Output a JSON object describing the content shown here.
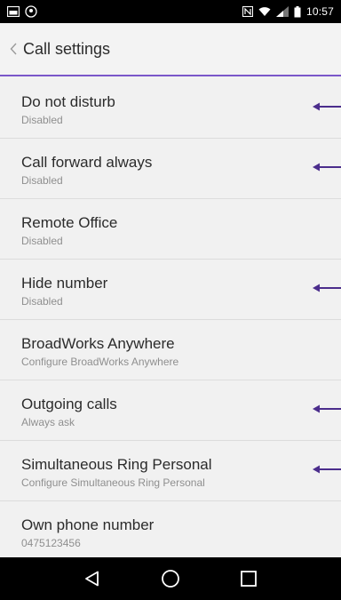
{
  "status_bar": {
    "time": "10:57",
    "left_icons": [
      "gallery-icon",
      "notification-icon"
    ],
    "right_icons": [
      "nfc-icon",
      "wifi-icon",
      "signal-icon",
      "battery-icon"
    ]
  },
  "header": {
    "back_icon": "chevron-left-icon",
    "title": "Call settings"
  },
  "accent_color": "#7a57c9",
  "settings": {
    "items": [
      {
        "title": "Do not disturb",
        "subtitle": "Disabled",
        "highlighted": true
      },
      {
        "title": "Call forward always",
        "subtitle": "Disabled",
        "highlighted": true
      },
      {
        "title": "Remote Office",
        "subtitle": "Disabled",
        "highlighted": false
      },
      {
        "title": "Hide number",
        "subtitle": "Disabled",
        "highlighted": true
      },
      {
        "title": "BroadWorks Anywhere",
        "subtitle": "Configure BroadWorks Anywhere",
        "highlighted": false
      },
      {
        "title": "Outgoing calls",
        "subtitle": "Always ask",
        "highlighted": true
      },
      {
        "title": "Simultaneous Ring Personal",
        "subtitle": "Configure Simultaneous Ring Personal",
        "highlighted": true
      },
      {
        "title": "Own phone number",
        "subtitle": "0475123456",
        "highlighted": false
      }
    ]
  },
  "nav_bar": {
    "icons": [
      "back-triangle-icon",
      "home-circle-icon",
      "recents-square-icon"
    ]
  }
}
